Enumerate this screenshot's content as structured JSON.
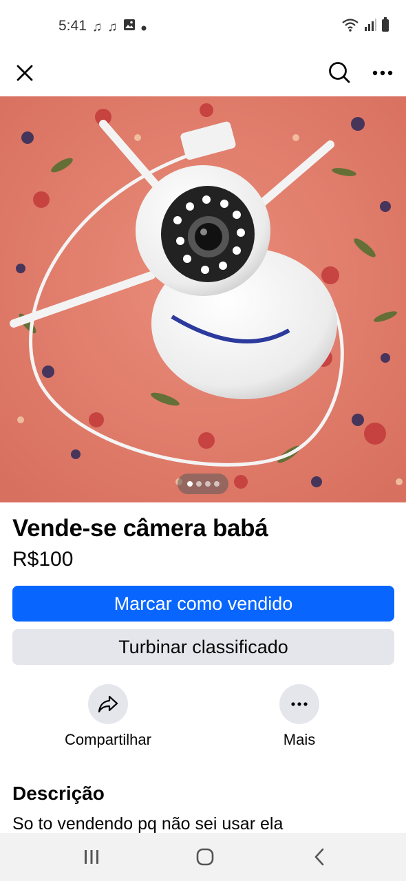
{
  "status_bar": {
    "time": "5:41",
    "left_icons": [
      "music-note-icon",
      "music-note-icon",
      "image-icon",
      "dot-icon"
    ],
    "right_icons": [
      "wifi-icon",
      "signal-icon",
      "battery-icon"
    ]
  },
  "top_bar": {
    "left_icon": "close-icon",
    "right_icons": [
      "search-icon",
      "more-icon"
    ]
  },
  "gallery": {
    "image_count": 4,
    "active_index": 0
  },
  "listing": {
    "title": "Vende-se câmera babá",
    "price": "R$100"
  },
  "buttons": {
    "primary_label": "Marcar como vendido",
    "secondary_label": "Turbinar classificado"
  },
  "actions": [
    {
      "label": "Compartilhar",
      "icon": "share-icon"
    },
    {
      "label": "Mais",
      "icon": "more-icon"
    }
  ],
  "description": {
    "heading": "Descrição",
    "text": "So to vendendo pq não sei usar ela"
  },
  "nav_bar": {
    "icons": [
      "recent-apps-icon",
      "home-icon",
      "back-icon"
    ]
  },
  "colors": {
    "primary": "#0866ff",
    "secondary_bg": "#e4e6eb",
    "text": "#050505"
  }
}
